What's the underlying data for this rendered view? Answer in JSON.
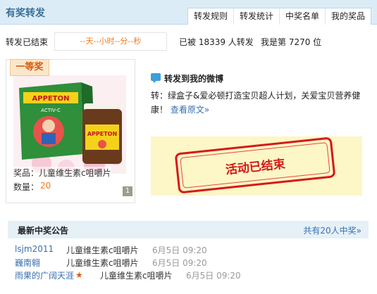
{
  "header": {
    "title": "有奖转发",
    "tabs": [
      "转发规则",
      "转发统计",
      "中奖名单",
      "我的奖品"
    ]
  },
  "status": {
    "label": "转发已结束",
    "countdown": "--天--小时--分--秒",
    "forward_count": "已被 18339 人转发",
    "rank": "我是第 7270 位"
  },
  "prize": {
    "tier": "一等奖",
    "name_label": "奖品：",
    "name": "儿童维生素c咀嚼片",
    "qty_label": "数量：",
    "qty": "20",
    "page": "1",
    "product_brand": "APPETON",
    "product_sub": "ACTIV-C"
  },
  "weibo": {
    "heading": "转发到我的微博",
    "text": "转：绿盒子&爱必顿打造宝贝超人计划，关爱宝贝营养健康！",
    "view_original": "查看原文»"
  },
  "ended": {
    "stamp": "活动已结束"
  },
  "winners": {
    "title": "最新中奖公告",
    "total": "共有20人中奖»",
    "rows": [
      {
        "user": "lsjm2011",
        "prize": "儿童维生素c咀嚼片",
        "time": "6月5日 09:20"
      },
      {
        "user": "巍南翱",
        "prize": "儿童维生素c咀嚼片",
        "time": "6月5日 09:20"
      },
      {
        "user": "雨果的广阔天涯",
        "prize": "儿童维生素c咀嚼片",
        "time": "6月5日 09:20"
      }
    ]
  },
  "colors": {
    "accent": "#3a6fb0",
    "orange": "#f07a1a",
    "stamp_red": "#d41a18",
    "header_bg": "#dcecf7"
  }
}
